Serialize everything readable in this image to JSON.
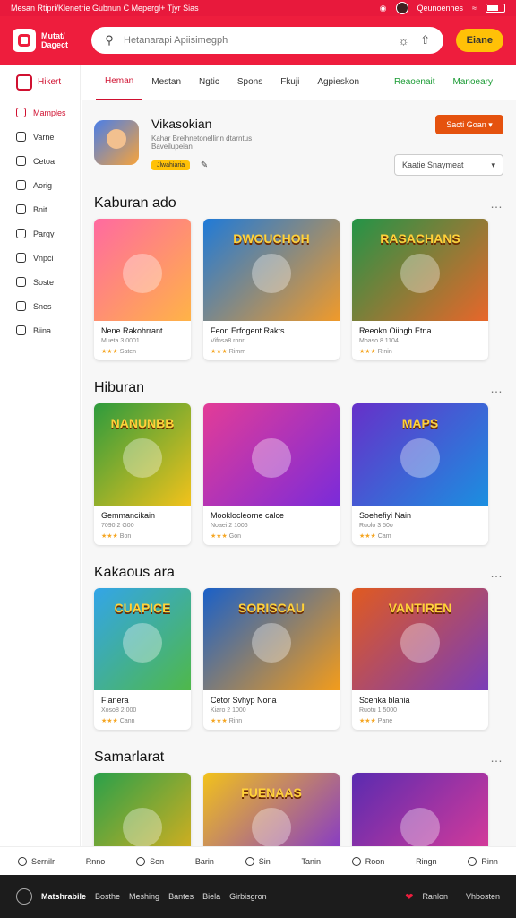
{
  "statusbar": {
    "left": "Mesan Rtipri/Klenetrie Gubnun  C  Mepergl+ Tjyr  Sias",
    "right_label": "Qeunoennes"
  },
  "header": {
    "logo_line1": "Mutat/",
    "logo_line2": "Dagect",
    "search_placeholder": "Hetanarapi Apiisimegph",
    "action_button": "Eiane"
  },
  "sidebar": {
    "title": "Hikert",
    "items": [
      {
        "label": "Mamples",
        "active": true
      },
      {
        "label": "Varne"
      },
      {
        "label": "Cetoa"
      },
      {
        "label": "Aorig"
      },
      {
        "label": "Bnit"
      },
      {
        "label": "Pargy"
      },
      {
        "label": "Vnpci"
      },
      {
        "label": "Soste"
      },
      {
        "label": "Snes"
      },
      {
        "label": "Biina"
      }
    ]
  },
  "tabs": [
    {
      "label": "Heman",
      "active": true
    },
    {
      "label": "Mestan"
    },
    {
      "label": "Ngtic"
    },
    {
      "label": "Spons"
    },
    {
      "label": "Fkuji"
    },
    {
      "label": "Agpieskon"
    },
    {
      "label": "Reaoenait",
      "green": true
    },
    {
      "label": "Manoeary",
      "green": true
    }
  ],
  "profile": {
    "name": "Vikasokian",
    "subtitle": "Kahar Breihnetonellinn dtarntus Baveilupeian",
    "tag": "Jlwahiaria",
    "button": "Sacti Goan",
    "select": "Kaatie Snaymeat"
  },
  "sections": [
    {
      "title": "Kaburan ado",
      "cards": [
        {
          "title": "Nene Rakohrrant",
          "meta": "Mueta 3 0001",
          "rating": "Saten",
          "banner": "",
          "colors": [
            "#ff6aa0",
            "#ffb347"
          ]
        },
        {
          "title": "Feon Erfogent Rakts",
          "meta": "Vifnsa8 ronr",
          "rating": "Rimm",
          "banner": "DWOUCHOH",
          "colors": [
            "#1f7ad8",
            "#f09a2a"
          ]
        },
        {
          "title": "Reeokn Oiingh Etna",
          "meta": "Moaso 8 1104",
          "rating": "Rinin",
          "banner": "RASACHANS",
          "colors": [
            "#239447",
            "#e8662a"
          ]
        }
      ]
    },
    {
      "title": "Hiburan",
      "cards": [
        {
          "title": "Gemmancikain",
          "meta": "7090 2 G00",
          "rating": "Bon",
          "banner": "NANUNBB",
          "colors": [
            "#2d9b3d",
            "#f2c21b"
          ]
        },
        {
          "title": "Mooklocleorne calce",
          "meta": "Noaei 2 1006",
          "rating": "Gon",
          "banner": "",
          "colors": [
            "#e33c97",
            "#7b2bd9"
          ]
        },
        {
          "title": "Soehefiyi Nain",
          "meta": "Ruolo 3 50o",
          "rating": "Cam",
          "banner": "MAPS",
          "colors": [
            "#6630c9",
            "#1b8fe0"
          ]
        }
      ]
    },
    {
      "title": "Kakaous ara",
      "cards": [
        {
          "title": "Fianera",
          "meta": "Xoso8 2 000",
          "rating": "Cann",
          "banner": "CUAPICE",
          "colors": [
            "#33a5e8",
            "#4fb84a"
          ]
        },
        {
          "title": "Cetor Svhyp Nona",
          "meta": "Kiaro 2 1000",
          "rating": "Rinn",
          "banner": "SORISCAU",
          "colors": [
            "#1a60c8",
            "#f39c1b"
          ]
        },
        {
          "title": "Scenka blania",
          "meta": "Ruotu 1 5000",
          "rating": "Pane",
          "banner": "VANTIREN",
          "colors": [
            "#e05a20",
            "#7a3db8"
          ]
        }
      ]
    },
    {
      "title": "Samarlarat",
      "cards": [
        {
          "title": "",
          "meta": "",
          "rating": "",
          "banner": "",
          "colors": [
            "#2aa04a",
            "#e8b01a"
          ]
        },
        {
          "title": "",
          "meta": "",
          "rating": "",
          "banner": "FUENAAS",
          "colors": [
            "#f2c21b",
            "#7b2bd9"
          ]
        },
        {
          "title": "",
          "meta": "",
          "rating": "",
          "banner": "",
          "colors": [
            "#5a2bb0",
            "#e33c97"
          ]
        }
      ]
    }
  ],
  "bottomnav": [
    {
      "label": "Sernilr"
    },
    {
      "label": "Rnno"
    },
    {
      "label": "Sen"
    },
    {
      "label": "Barin"
    },
    {
      "label": "Sin"
    },
    {
      "label": "Tanin"
    },
    {
      "label": "Roon"
    },
    {
      "label": "Ringn"
    },
    {
      "label": "Rinn"
    }
  ],
  "footer": {
    "brand": "Matshrabile",
    "links": [
      "Bosthe",
      "Meshing",
      "Bantes",
      "Biela",
      "Girbisgron"
    ],
    "right1": "Ranlon",
    "right2": "Vhbosten"
  }
}
